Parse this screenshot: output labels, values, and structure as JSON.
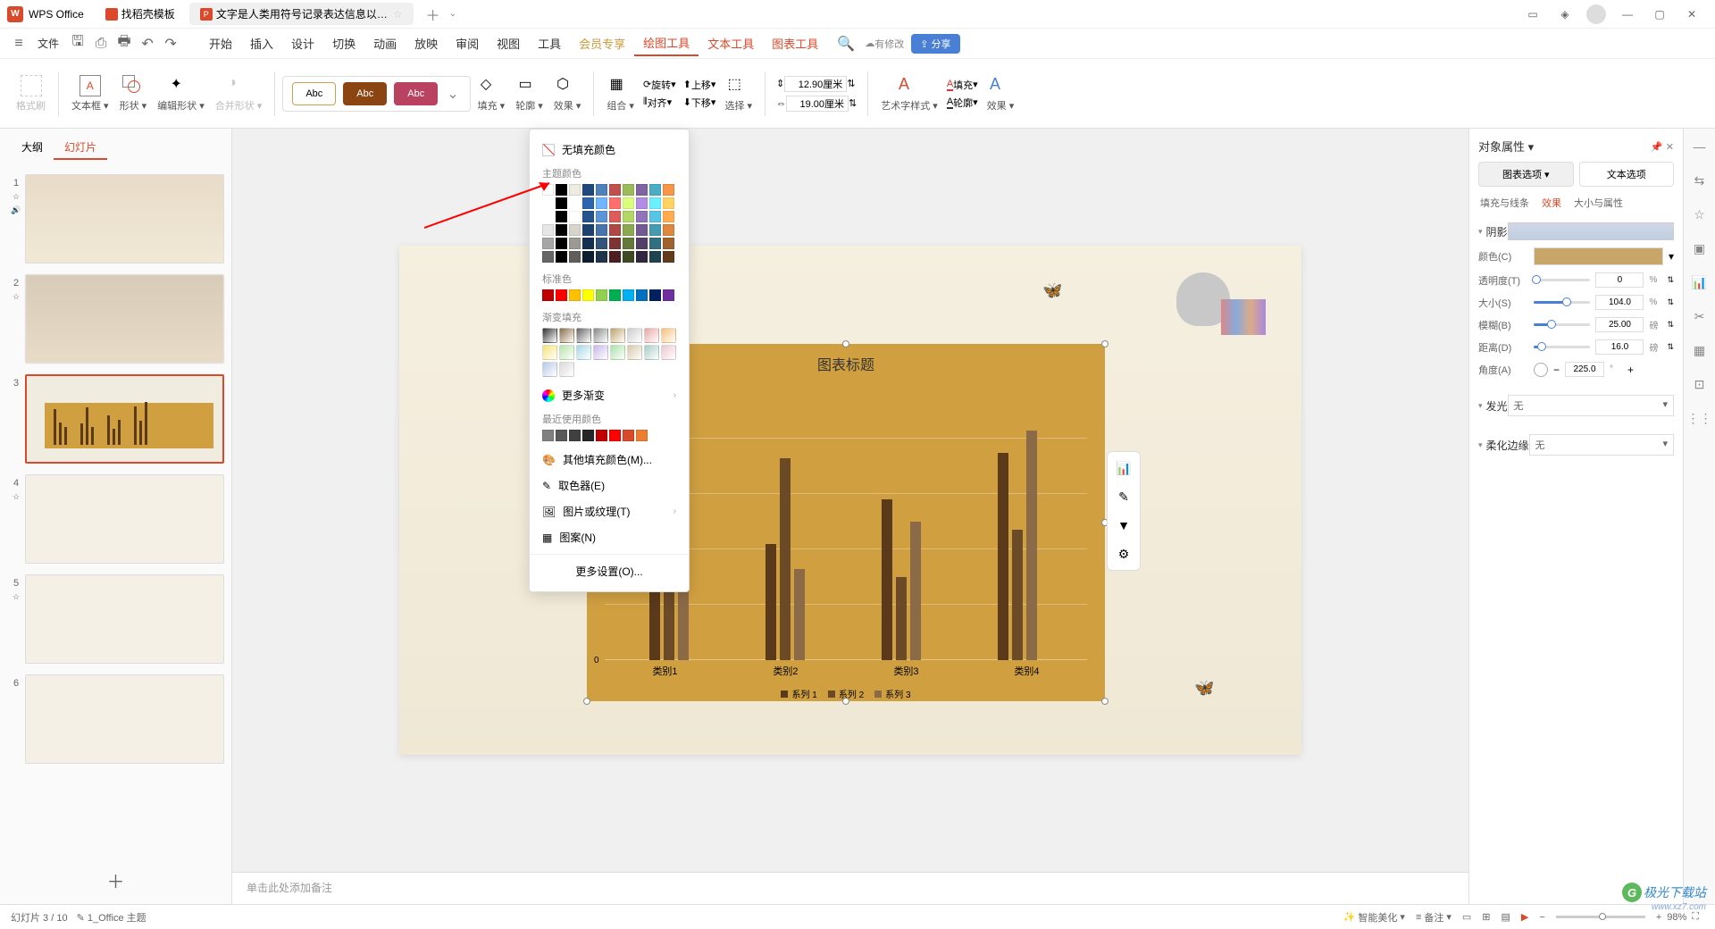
{
  "app_name": "WPS Office",
  "tabs": [
    {
      "label": "找稻壳模板",
      "icon_color": "#d84a2b"
    },
    {
      "label": "文字是人类用符号记录表达信息以…",
      "icon_color": "#d84a2b",
      "icon_letter": "P"
    }
  ],
  "file_menu": "文件",
  "modify_label": "有修改",
  "share_label": "分享",
  "menu": {
    "items": [
      "开始",
      "插入",
      "设计",
      "切换",
      "动画",
      "放映",
      "审阅",
      "视图",
      "工具",
      "会员专享",
      "绘图工具",
      "文本工具",
      "图表工具"
    ],
    "active_index": 10,
    "orange_indices": [
      10,
      11,
      12
    ]
  },
  "ribbon": {
    "format_painter": "格式刷",
    "textbox": "文本框",
    "shape": "形状",
    "edit_shape": "编辑形状",
    "merge_shape": "合并形状",
    "abc": "Abc",
    "fill": "填充",
    "outline": "轮廓",
    "effect": "效果",
    "group": "组合",
    "rotate": "旋转",
    "align": "对齐",
    "move_up": "上移",
    "move_down": "下移",
    "select": "选择",
    "height_val": "12.90厘米",
    "width_val": "19.00厘米",
    "wordart": "艺术字样式",
    "fill2": "填充",
    "outline2": "轮廓",
    "effect2": "效果"
  },
  "slidepanel": {
    "tab_outline": "大纲",
    "tab_slides": "幻灯片",
    "count": 6
  },
  "fill_dropdown": {
    "no_fill": "无填充颜色",
    "theme_colors": "主题颜色",
    "standard_colors": "标准色",
    "gradient_fill": "渐变填充",
    "more_gradient": "更多渐变",
    "recent_colors": "最近使用颜色",
    "other_fill": "其他填充颜色(M)...",
    "eyedropper": "取色器(E)",
    "picture_texture": "图片或纹理(T)",
    "pattern": "图案(N)",
    "more_settings": "更多设置(O)..."
  },
  "chart": {
    "title": "图表标题",
    "categories": [
      "类别1",
      "类别2",
      "类别3",
      "类别4"
    ],
    "legend": [
      "系列 1",
      "系列 2",
      "系列 3"
    ],
    "yaxis_zero": "0"
  },
  "chart_data": {
    "type": "bar",
    "title": "图表标题",
    "categories": [
      "类别1",
      "类别2",
      "类别3",
      "类别4"
    ],
    "series": [
      {
        "name": "系列 1",
        "values": [
          4.2,
          2.5,
          3.5,
          4.5
        ]
      },
      {
        "name": "系列 2",
        "values": [
          2.3,
          4.4,
          1.8,
          2.8
        ]
      },
      {
        "name": "系列 3",
        "values": [
          2.0,
          2.0,
          3.0,
          5.0
        ]
      }
    ],
    "ylim": [
      0,
      6
    ],
    "xlabel": "",
    "ylabel": ""
  },
  "notes_placeholder": "单击此处添加备注",
  "props": {
    "title": "对象属性",
    "tab_chart": "图表选项",
    "tab_text": "文本选项",
    "sub_fill_line": "填充与线条",
    "sub_effect": "效果",
    "sub_size": "大小与属性",
    "shadow": "阴影",
    "color_label": "颜色(C)",
    "color_val": "#c8a568",
    "transparency_label": "透明度(T)",
    "transparency_val": "0",
    "size_label": "大小(S)",
    "size_val": "104.0",
    "blur_label": "模糊(B)",
    "blur_val": "25.00",
    "distance_label": "距离(D)",
    "distance_val": "16.0",
    "angle_label": "角度(A)",
    "angle_val": "225.0",
    "pct": "%",
    "pt": "磅",
    "deg": "°",
    "glow": "发光",
    "soft_edge": "柔化边缘",
    "none": "无"
  },
  "status": {
    "slide_info": "幻灯片 3 / 10",
    "theme": "1_Office 主题",
    "smart_beautify": "智能美化",
    "notes_btn": "备注",
    "zoom": "98%"
  },
  "watermark": {
    "main": "极光下载站",
    "sub": "www.xz7.com"
  }
}
